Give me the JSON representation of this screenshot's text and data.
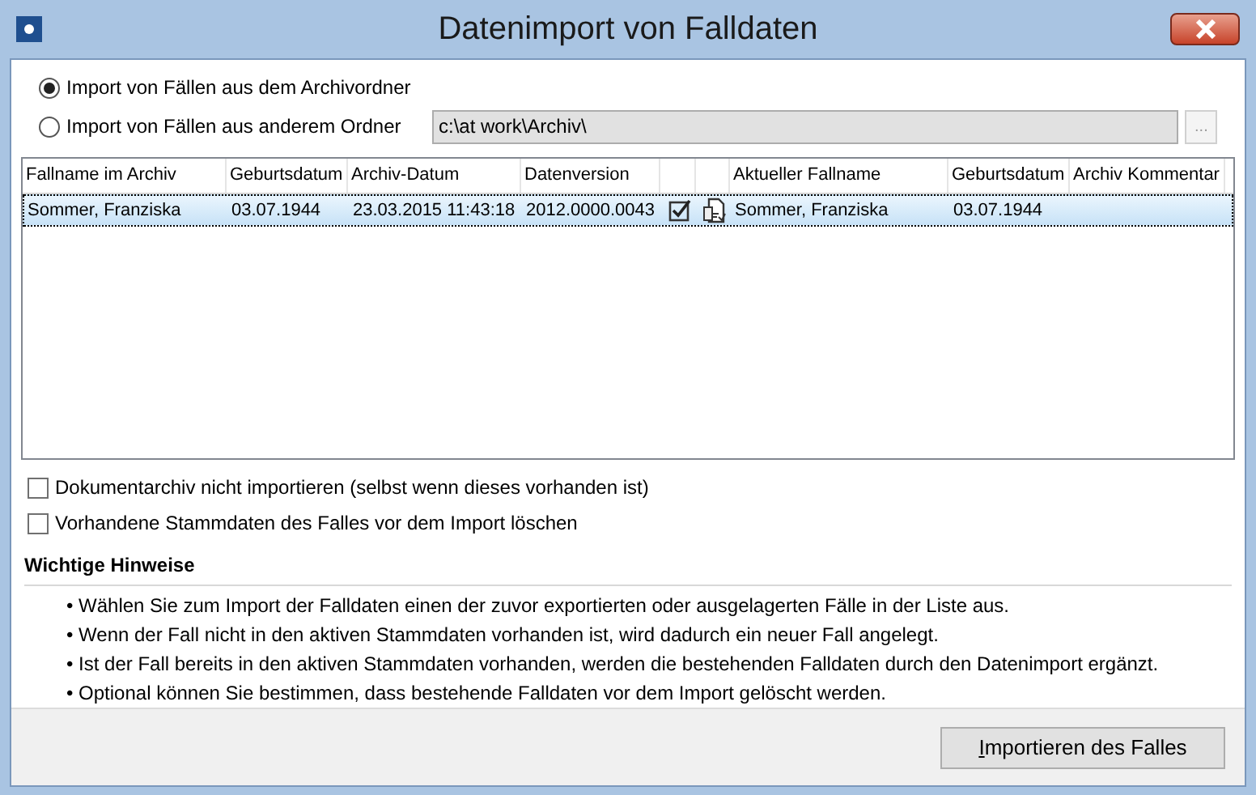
{
  "window": {
    "title": "Datenimport von Falldaten"
  },
  "source_options": [
    {
      "label": "Import von Fällen aus dem Archivordner",
      "selected": true
    },
    {
      "label": "Import von Fällen aus anderem Ordner",
      "selected": false
    }
  ],
  "folder_field": {
    "value": "c:\\at work\\Archiv\\",
    "disabled": true
  },
  "browse_button": {
    "label": "...",
    "disabled": true
  },
  "table": {
    "columns": [
      {
        "kind": "text",
        "label": "Fallname im Archiv"
      },
      {
        "kind": "text",
        "label": "Geburtsdatum"
      },
      {
        "kind": "text",
        "label": "Archiv-Datum"
      },
      {
        "kind": "text",
        "label": "Datenversion"
      },
      {
        "kind": "icon"
      },
      {
        "kind": "icon"
      },
      {
        "kind": "text",
        "label": "Aktueller Fallname"
      },
      {
        "kind": "text",
        "label": "Geburtsdatum"
      },
      {
        "kind": "text",
        "label": "Archiv Kommentar"
      }
    ],
    "rows": [
      {
        "selected": true,
        "cells": [
          "Sommer, Franziska",
          "03.07.1944",
          "23.03.2015 11:43:18",
          "2012.0000.0043",
          "Sommer, Franziska",
          "03.07.1944"
        ]
      }
    ]
  },
  "options": [
    {
      "label": "Dokumentarchiv nicht importieren (selbst wenn dieses vorhanden ist)",
      "checked": false
    },
    {
      "label": "Vorhandene Stammdaten des Falles vor dem Import löschen",
      "checked": false
    }
  ],
  "notes": {
    "heading": "Wichtige Hinweise",
    "items": [
      "• Wählen Sie zum Import der Falldaten einen der zuvor exportierten oder ausgelagerten Fälle in der Liste aus.",
      "• Wenn der Fall nicht in den aktiven Stammdaten vorhanden ist, wird dadurch ein neuer Fall angelegt.",
      "• Ist der Fall bereits in den aktiven Stammdaten vorhanden, werden die bestehenden Falldaten durch den Datenimport ergänzt.",
      "• Optional können Sie bestimmen, dass bestehende Falldaten vor dem Import gelöscht werden."
    ]
  },
  "import_button": {
    "label": "Importieren des Falles"
  }
}
